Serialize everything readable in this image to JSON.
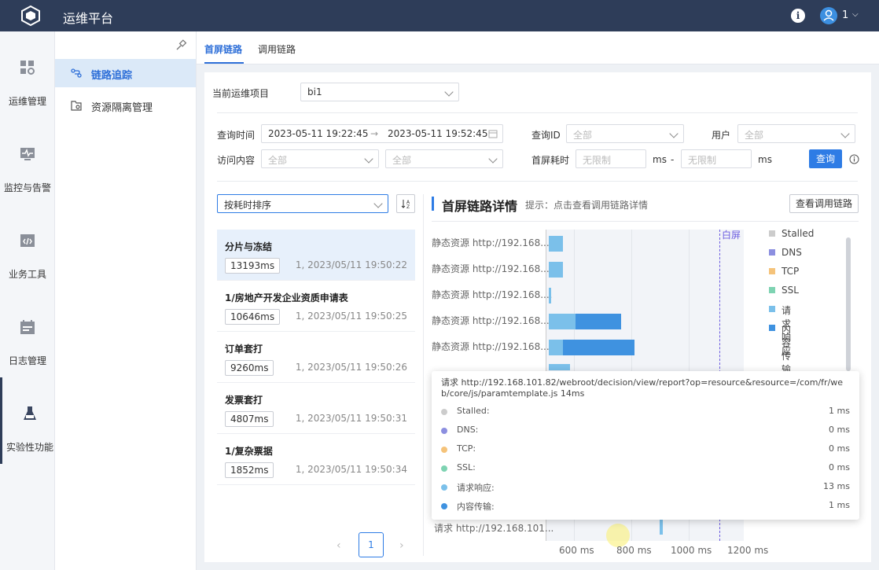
{
  "app": {
    "title": "运维平台",
    "user": "1"
  },
  "leftnav": [
    "运维管理",
    "监控与告警",
    "业务工具",
    "日志管理",
    "实验性功能"
  ],
  "subnav": [
    "链路追踪",
    "资源隔离管理"
  ],
  "tabs": [
    "首屏链路",
    "调用链路"
  ],
  "filters": {
    "project_label": "当前运维项目",
    "project_value": "bi1",
    "time_label": "查询时间",
    "time_start": "2023-05-11 19:22:45",
    "time_arrow": "→",
    "time_end": "2023-05-11 19:52:45",
    "queryid_label": "查询ID",
    "user_label": "用户",
    "all": "全部",
    "content_label": "访问内容",
    "screen_label": "首屏耗时",
    "unlimited": "无限制",
    "unit": "ms",
    "dash": "-",
    "query_btn": "查询"
  },
  "sort": {
    "label": "按耗时排序",
    "icon": "sort-icon"
  },
  "list": [
    {
      "name": "分片与冻结",
      "dur": "13193ms",
      "meta": "1, 2023/05/11 19:50:22"
    },
    {
      "name": "1/房地产开发企业资质申请表",
      "dur": "10646ms",
      "meta": "1, 2023/05/11 19:50:25"
    },
    {
      "name": "订单套打",
      "dur": "9260ms",
      "meta": "1, 2023/05/11 19:50:26"
    },
    {
      "name": "发票套打",
      "dur": "4807ms",
      "meta": "1, 2023/05/11 19:50:31"
    },
    {
      "name": "1/复杂票据",
      "dur": "1852ms",
      "meta": "1, 2023/05/11 19:50:34"
    }
  ],
  "pager": {
    "prev": "‹",
    "current": "1",
    "next": "›"
  },
  "detail": {
    "title": "首屏链路详情",
    "hint": "提示：点击查看调用链路详情",
    "view_btn": "查看调用链路",
    "white_screen": "白屏"
  },
  "chart_data": {
    "type": "bar",
    "rows": [
      "静态资源 http://192.168....",
      "静态资源 http://192.168....",
      "静态资源 http://192.168....",
      "静态资源 http://192.168....",
      "静态资源 http://192.168....",
      "请求 http://192.168.101..."
    ],
    "legend": [
      {
        "name": "Stalled",
        "color": "#cccccc"
      },
      {
        "name": "DNS",
        "color": "#8c8fe0"
      },
      {
        "name": "TCP",
        "color": "#f5c37a"
      },
      {
        "name": "SSL",
        "color": "#7ed3b2"
      },
      {
        "name": "请求响应",
        "color": "#7bc0ea"
      },
      {
        "name": "内容传输",
        "color": "#3f92e0"
      }
    ],
    "ticks": [
      "600 ms",
      "800 ms",
      "1000 ms",
      "1200 ms"
    ]
  },
  "tooltip": {
    "title": "请求 http://192.168.101.82/webroot/decision/view/report?op=resource&resource=/com/fr/web/core/js/paramtemplate.js 14ms",
    "rows": [
      {
        "k": "Stalled:",
        "v": "1 ms",
        "color": "#cccccc"
      },
      {
        "k": "DNS:",
        "v": "0 ms",
        "color": "#8c8fe0"
      },
      {
        "k": "TCP:",
        "v": "0 ms",
        "color": "#f5c37a"
      },
      {
        "k": "SSL:",
        "v": "0 ms",
        "color": "#7ed3b2"
      },
      {
        "k": "请求响应:",
        "v": "13 ms",
        "color": "#7bc0ea"
      },
      {
        "k": "内容传输:",
        "v": "1 ms",
        "color": "#3f92e0"
      }
    ]
  }
}
